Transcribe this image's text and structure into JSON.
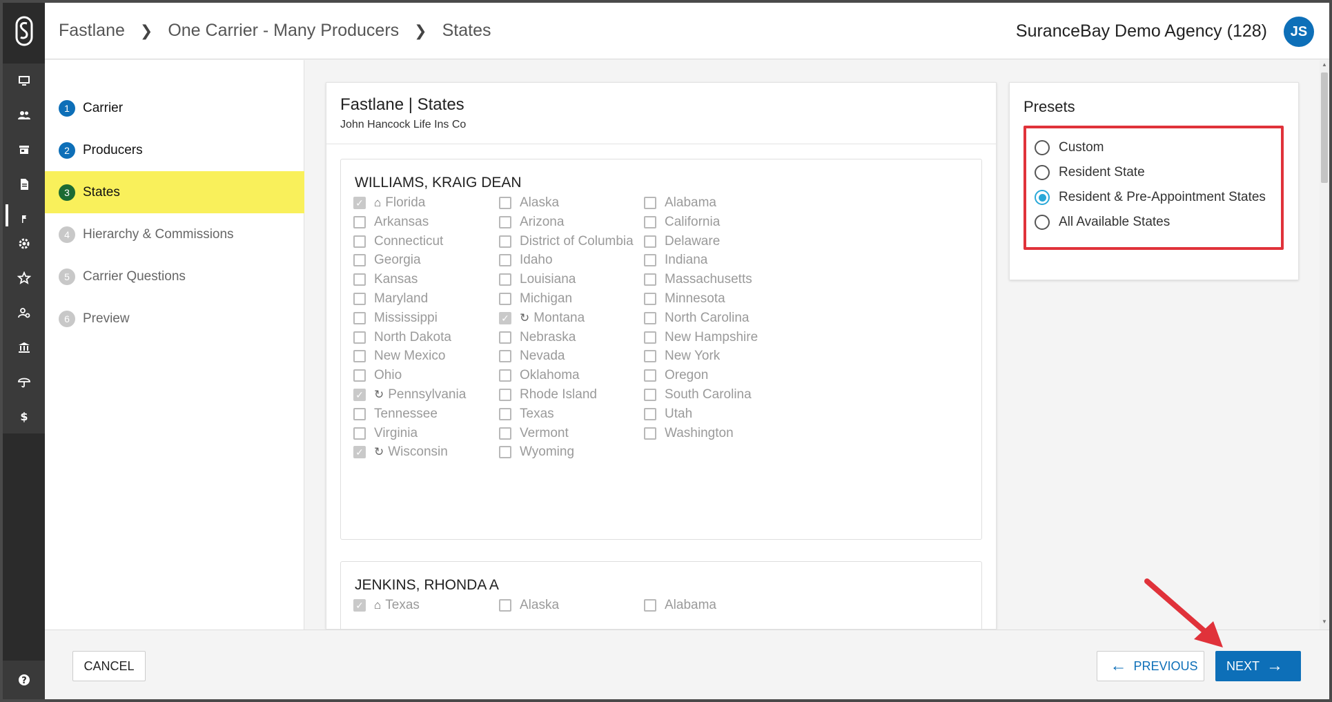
{
  "header": {
    "breadcrumb": [
      "Fastlane",
      "One Carrier - Many Producers",
      "States"
    ],
    "agency": "SuranceBay Demo Agency (128)",
    "user_initials": "JS"
  },
  "rail": {
    "icons": [
      "monitor-icon",
      "people-icon",
      "store-icon",
      "document-icon",
      "flag-icon",
      "gear-icon",
      "star-icon",
      "user-settings-icon",
      "bank-icon",
      "umbrella-icon",
      "dollar-icon"
    ],
    "help_icon": "help-icon"
  },
  "stepper": {
    "steps": [
      {
        "num": "1",
        "label": "Carrier",
        "state": "done"
      },
      {
        "num": "2",
        "label": "Producers",
        "state": "done"
      },
      {
        "num": "3",
        "label": "States",
        "state": "current"
      },
      {
        "num": "4",
        "label": "Hierarchy & Commissions",
        "state": "todo"
      },
      {
        "num": "5",
        "label": "Carrier Questions",
        "state": "todo"
      },
      {
        "num": "6",
        "label": "Preview",
        "state": "todo"
      }
    ]
  },
  "states_card": {
    "title": "Fastlane | States",
    "subtitle": "John Hancock Life Ins Co",
    "producers": [
      {
        "name": "WILLIAMS, KRAIG DEAN",
        "states": [
          {
            "label": "Florida",
            "checked": true,
            "icon": "home"
          },
          {
            "label": "Alaska",
            "checked": false
          },
          {
            "label": "Alabama",
            "checked": false
          },
          {
            "label": "Arkansas",
            "checked": false
          },
          {
            "label": "Arizona",
            "checked": false
          },
          {
            "label": "California",
            "checked": false
          },
          {
            "label": "Connecticut",
            "checked": false
          },
          {
            "label": "District of Columbia",
            "checked": false
          },
          {
            "label": "Delaware",
            "checked": false
          },
          {
            "label": "Georgia",
            "checked": false
          },
          {
            "label": "Idaho",
            "checked": false
          },
          {
            "label": "Indiana",
            "checked": false
          },
          {
            "label": "Kansas",
            "checked": false
          },
          {
            "label": "Louisiana",
            "checked": false
          },
          {
            "label": "Massachusetts",
            "checked": false
          },
          {
            "label": "Maryland",
            "checked": false
          },
          {
            "label": "Michigan",
            "checked": false
          },
          {
            "label": "Minnesota",
            "checked": false
          },
          {
            "label": "Mississippi",
            "checked": false
          },
          {
            "label": "Montana",
            "checked": true,
            "icon": "refresh"
          },
          {
            "label": "North Carolina",
            "checked": false
          },
          {
            "label": "North Dakota",
            "checked": false
          },
          {
            "label": "Nebraska",
            "checked": false
          },
          {
            "label": "New Hampshire",
            "checked": false
          },
          {
            "label": "New Mexico",
            "checked": false
          },
          {
            "label": "Nevada",
            "checked": false
          },
          {
            "label": "New York",
            "checked": false
          },
          {
            "label": "Ohio",
            "checked": false
          },
          {
            "label": "Oklahoma",
            "checked": false
          },
          {
            "label": "Oregon",
            "checked": false
          },
          {
            "label": "Pennsylvania",
            "checked": true,
            "icon": "refresh"
          },
          {
            "label": "Rhode Island",
            "checked": false
          },
          {
            "label": "South Carolina",
            "checked": false
          },
          {
            "label": "Tennessee",
            "checked": false
          },
          {
            "label": "Texas",
            "checked": false
          },
          {
            "label": "Utah",
            "checked": false
          },
          {
            "label": "Virginia",
            "checked": false
          },
          {
            "label": "Vermont",
            "checked": false
          },
          {
            "label": "Washington",
            "checked": false
          },
          {
            "label": "Wisconsin",
            "checked": true,
            "icon": "refresh"
          },
          {
            "label": "Wyoming",
            "checked": false
          }
        ]
      },
      {
        "name": "JENKINS, RHONDA A",
        "states": [
          {
            "label": "Texas",
            "checked": true,
            "icon": "home"
          },
          {
            "label": "Alaska",
            "checked": false
          },
          {
            "label": "Alabama",
            "checked": false
          }
        ]
      }
    ]
  },
  "presets": {
    "title": "Presets",
    "options": [
      {
        "label": "Custom",
        "selected": false
      },
      {
        "label": "Resident State",
        "selected": false
      },
      {
        "label": "Resident & Pre-Appointment States",
        "selected": true
      },
      {
        "label": "All Available States",
        "selected": false
      }
    ]
  },
  "footer": {
    "cancel": "CANCEL",
    "previous": "PREVIOUS",
    "next": "NEXT"
  },
  "colors": {
    "brand_blue": "#0d6fb8",
    "current_step_highlight": "#f9f05b",
    "annotation_red": "#e0323a",
    "radio_selected": "#29a8d8"
  }
}
